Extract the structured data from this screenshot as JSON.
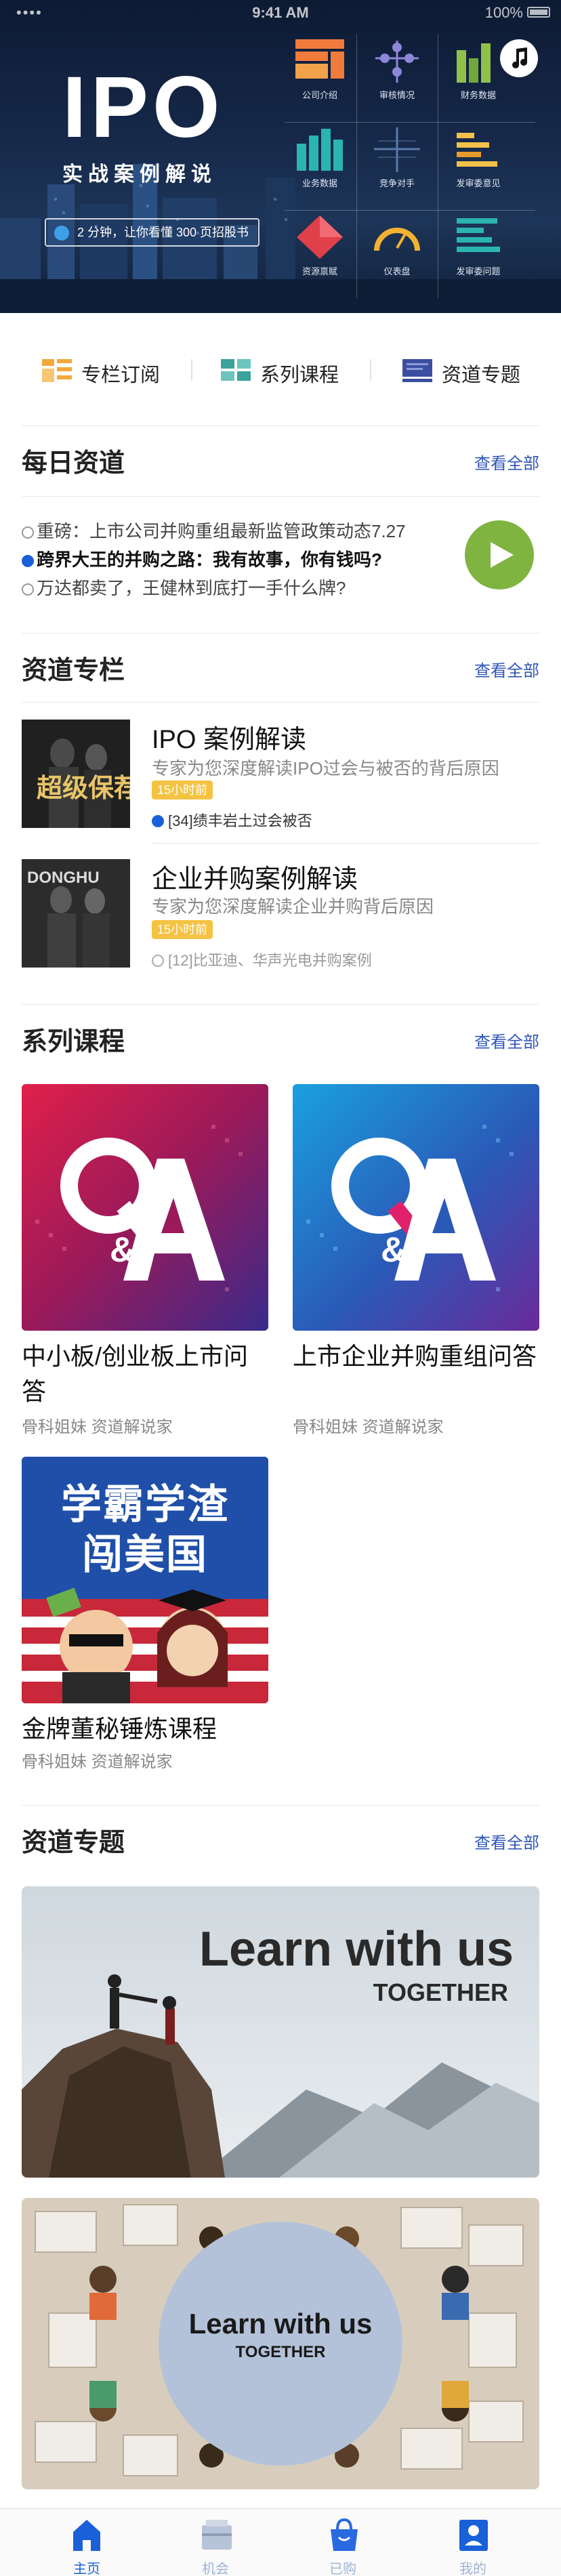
{
  "status_bar": {
    "carrier": "•••• ",
    "time": "9:41 AM",
    "battery": "100%"
  },
  "hero": {
    "title": "IPO",
    "subtitle": "实战案例解说",
    "tag": "2 分钟，让你看懂 300 页招股书",
    "grid": [
      {
        "label": "公司介绍",
        "icon": "company-intro-icon"
      },
      {
        "label": "审核情况",
        "icon": "review-status-icon"
      },
      {
        "label": "财务数据",
        "icon": "financial-data-icon"
      },
      {
        "label": "业务数据",
        "icon": "business-data-icon"
      },
      {
        "label": "竞争对手",
        "icon": "competitor-icon"
      },
      {
        "label": "发审委意见",
        "icon": "committee-opinion-icon"
      },
      {
        "label": "资源禀赋",
        "icon": "resource-icon"
      },
      {
        "label": "仪表盘",
        "icon": "dashboard-icon"
      },
      {
        "label": "发审委问题",
        "icon": "committee-question-icon"
      }
    ]
  },
  "nav": [
    {
      "label": "专栏订阅",
      "icon": "column-subscribe-icon",
      "color": "#f2a93b"
    },
    {
      "label": "系列课程",
      "icon": "series-course-icon",
      "color": "#3aa39b"
    },
    {
      "label": "资道专题",
      "icon": "topic-icon",
      "color": "#3a4fa0"
    }
  ],
  "daily": {
    "title": "每日资道",
    "view_all": "查看全部",
    "items": [
      {
        "text": "重磅：上市公司并购重组最新监管政策动态7.27",
        "active": false
      },
      {
        "text": "跨界大王的并购之路：我有故事，你有钱吗?",
        "active": true
      },
      {
        "text": "万达都卖了，王健林到底打一手什么牌?",
        "active": false
      }
    ]
  },
  "columns": {
    "title": "资道专栏",
    "view_all": "查看全部",
    "items": [
      {
        "title": "IPO 案例解读",
        "desc": "专家为您深度解读IPO过会与被否的背后原因",
        "badge": "15小时前",
        "latest": "[34]绩丰岩土过会被否",
        "thumb_text": "超级保荐"
      },
      {
        "title": "企业并购案例解读",
        "desc": "专家为您深度解读企业并购背后原因",
        "badge": "15小时前",
        "latest": "[12]比亚迪、华声光电并购案例",
        "thumb_text": "DONGHU"
      }
    ]
  },
  "series": {
    "title": "系列课程",
    "view_all": "查看全部",
    "items": [
      {
        "title": "中小板/创业板上市问答",
        "author": "骨科姐妹  资道解说家",
        "art": "Q&A"
      },
      {
        "title": "上市企业并购重组问答",
        "author": "骨科姐妹  资道解说家",
        "art": "Q&A"
      },
      {
        "title": "金牌董秘锤炼课程",
        "author": "骨科姐妹  资道解说家",
        "art_line1": "学霸学渣",
        "art_line2": "闯美国"
      }
    ]
  },
  "topics": {
    "title": "资道专题",
    "view_all": "查看全部",
    "items": [
      {
        "line1": "Learn with us",
        "line2": "TOGETHER"
      },
      {
        "line1": "Learn with us",
        "line2": "TOGETHER"
      }
    ]
  },
  "tabbar": [
    {
      "label": "主页",
      "icon": "home-icon",
      "active": true
    },
    {
      "label": "机会",
      "icon": "opportunity-icon",
      "active": false
    },
    {
      "label": "已购",
      "icon": "purchased-bag-icon",
      "active": false
    },
    {
      "label": "我的",
      "icon": "profile-icon",
      "active": false
    }
  ]
}
